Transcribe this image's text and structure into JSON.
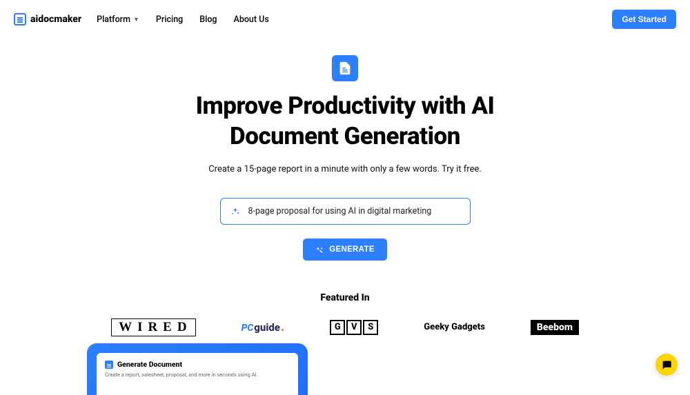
{
  "nav": {
    "brand": "aidocmaker",
    "links": [
      "Platform",
      "Pricing",
      "Blog",
      "About Us"
    ],
    "cta": "Get Started"
  },
  "hero": {
    "title_line1": "Improve Productivity with AI",
    "title_line2": "Document Generation",
    "subtitle": "Create a 15-page report in a minute with only a few words. Try it free.",
    "prompt": "8-page proposal for using AI in digital marketing",
    "generate": "GENERATE"
  },
  "featured": {
    "title": "Featured In",
    "wired": "WIRED",
    "pcguide_pc": "PC",
    "pcguide_guide": "guide",
    "gvs": [
      "G",
      "V",
      "S"
    ],
    "geeky": "Geeky Gadgets",
    "beebom": "Beebom"
  },
  "preview": {
    "title": "Generate Document",
    "desc": "Create a report, salesheet, proposal, and more in seconds using AI."
  }
}
